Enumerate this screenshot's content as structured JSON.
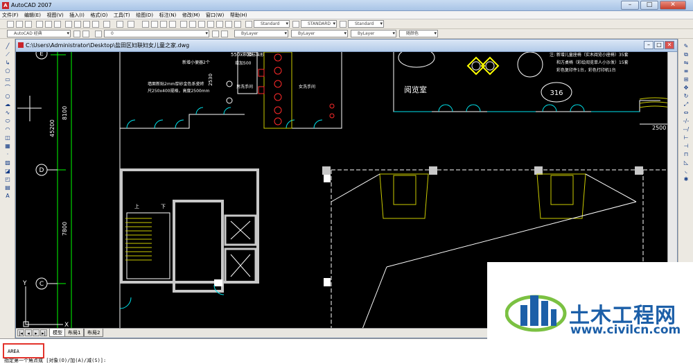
{
  "window": {
    "title": "AutoCAD 2007",
    "minimize": "–",
    "maximize": "□",
    "close": "✕"
  },
  "menu": [
    "文件(F)",
    "编辑(E)",
    "视图(V)",
    "插入(I)",
    "格式(O)",
    "工具(T)",
    "绘图(D)",
    "标注(N)",
    "修改(M)",
    "窗口(W)",
    "帮助(H)"
  ],
  "toolbar": {
    "text_style": "Standard",
    "dim_style": "STANDARD",
    "table_style": "Standard",
    "workspace": "AutoCAD 经典",
    "layer": "0",
    "color": "ByLayer",
    "linetype": "ByLayer",
    "lineweight": "ByLayer",
    "plotstyle": "随颜色"
  },
  "document": {
    "path": "C:\\Users\\Administrator\\Desktop\\盐田区妇联妇女儿童之家.dwg"
  },
  "drawing": {
    "axes": [
      "E",
      "D",
      "C"
    ],
    "dims": [
      "8100",
      "45200",
      "7800",
      "550x800",
      "2500",
      "2530",
      "2500"
    ],
    "labels": {
      "room_reading": "阅览室",
      "room_no": "316",
      "up": "上",
      "down": "下",
      "note_title": "新增小便器2个",
      "note_tile": "墙面新贴2mm厚砂金色系瓷砖",
      "note_tile2": "尺250x400规格，高度2500mm",
      "note_urinal_cn": "接标准形",
      "note_bike": "增加500",
      "note_handwash": "男洗手间",
      "note_handwash2": "女洗手间",
      "note_right1": "注: 新增儿童座椅（实木阅览小座椅）35套",
      "note_right2": "和方桌椅（彩绘阅览单人小沙发）15套",
      "note_right3": "彩色复印件1台，彩色打印机1台",
      "ucs_y": "Y",
      "ucs_x": "X"
    }
  },
  "tabs": {
    "model": "模型",
    "layout1": "布局1",
    "layout2": "布局2"
  },
  "command": {
    "history": "AREA",
    "prompt": "指定第一个角点或 [对象(O)/加(A)/减(S)]:"
  },
  "watermark": {
    "cn": "土木工程网",
    "url": "www.civilcn.com"
  }
}
